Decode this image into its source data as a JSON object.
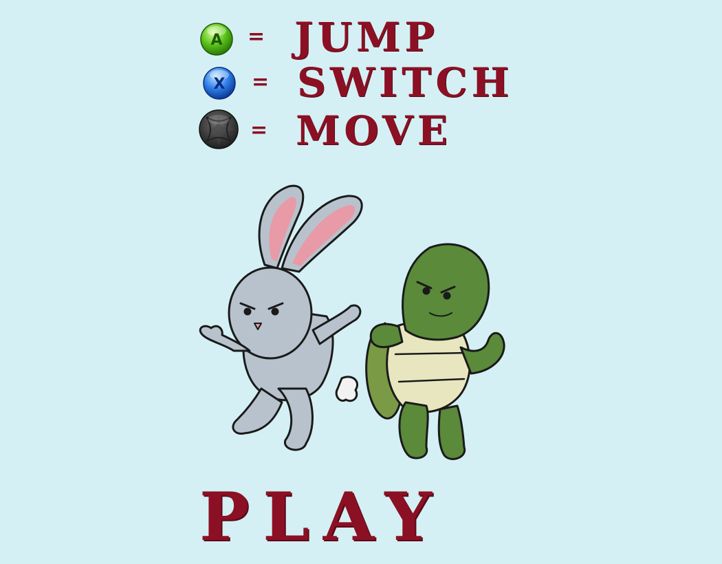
{
  "controls": [
    {
      "button": "A",
      "button_icon": "a-button-icon",
      "button_color": "#3fb10f",
      "equals": "=",
      "action": "Jump"
    },
    {
      "button": "X",
      "button_icon": "x-button-icon",
      "button_color": "#1a5fd0",
      "equals": "=",
      "action": "Switch"
    },
    {
      "button": "",
      "button_icon": "dpad-icon",
      "button_color": "#333333",
      "equals": "=",
      "action": "Move"
    }
  ],
  "characters": [
    "rabbit",
    "turtle"
  ],
  "play_label": "Play",
  "colors": {
    "background": "#d4f0f4",
    "text": "#8c1024"
  }
}
